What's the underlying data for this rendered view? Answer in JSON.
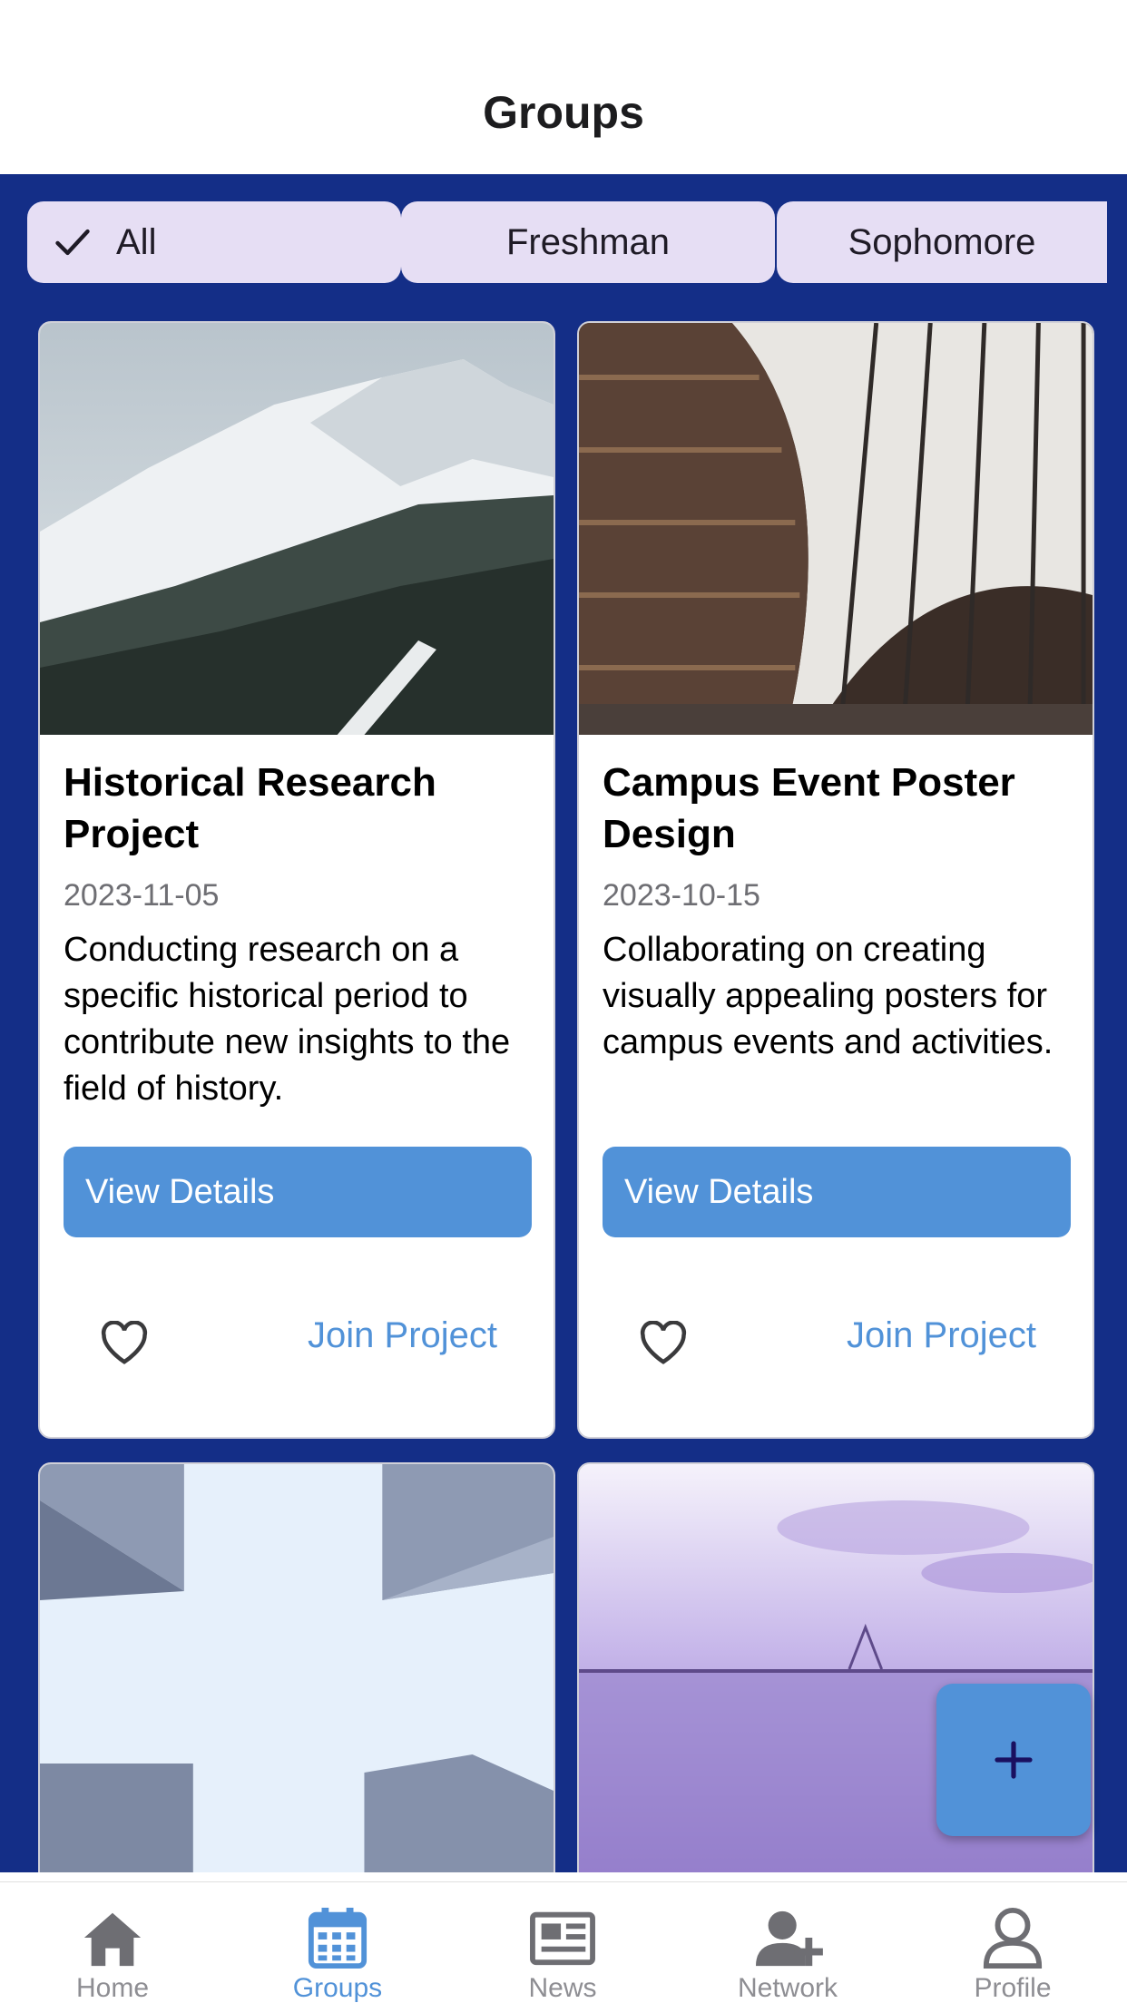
{
  "header": {
    "title": "Groups"
  },
  "filters": [
    {
      "label": "All",
      "selected": true
    },
    {
      "label": "Freshman",
      "selected": false
    },
    {
      "label": "Sophomore",
      "selected": false
    }
  ],
  "cards": [
    {
      "title": "Historical Research Project",
      "date": "2023-11-05",
      "description": "Conducting research on a specific historical period to contribute new insights to the field of history.",
      "view_label": "View Details",
      "join_label": "Join Project",
      "image": "snowy-mountain-photo"
    },
    {
      "title": "Campus Event Poster Design",
      "date": "2023-10-15",
      "description": "Collaborating on creating visually appealing posters for campus events and activities.",
      "view_label": "View Details",
      "join_label": "Join Project",
      "image": "library-bookshelves-photo"
    },
    {
      "image": "buildings-sky-photo"
    },
    {
      "image": "sea-bridge-photo"
    }
  ],
  "fab": {
    "icon": "plus-icon"
  },
  "tabbar": [
    {
      "label": "Home",
      "icon": "home-icon",
      "active": false
    },
    {
      "label": "Groups",
      "icon": "calendar-icon",
      "active": true
    },
    {
      "label": "News",
      "icon": "newspaper-icon",
      "active": false
    },
    {
      "label": "Network",
      "icon": "add-user-icon",
      "active": false
    },
    {
      "label": "Profile",
      "icon": "profile-icon",
      "active": false
    }
  ],
  "colors": {
    "accent": "#5192d8",
    "background": "#142e87",
    "chip": "#e6def4",
    "fab_icon": "#1a1060"
  }
}
